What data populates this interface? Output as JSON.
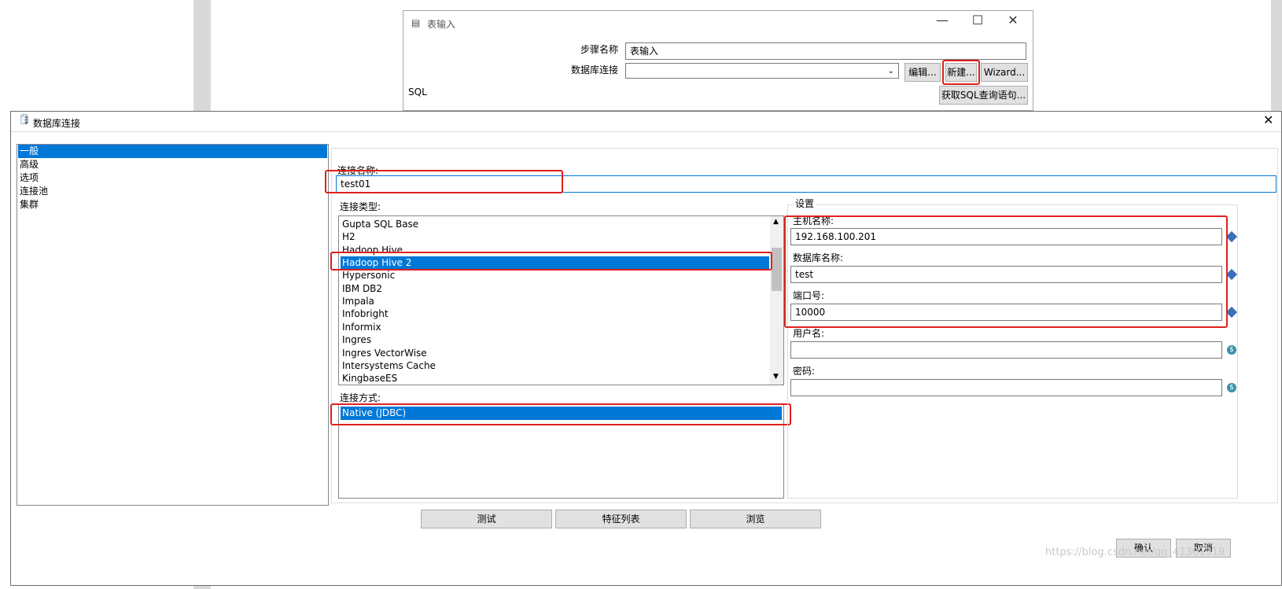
{
  "table_input": {
    "title": "表输入",
    "step_name_label": "步骤名称",
    "step_name_value": "表输入",
    "db_conn_label": "数据库连接",
    "db_conn_value": "",
    "edit_button": "编辑...",
    "new_button": "新建...",
    "wizard_button": "Wizard...",
    "sql_label": "SQL",
    "get_sql_button": "获取SQL查询语句..."
  },
  "dialog": {
    "title": "数据库连接",
    "nav_items": [
      "一般",
      "高级",
      "选项",
      "连接池",
      "集群"
    ],
    "conn_name_label": "连接名称:",
    "conn_name_value": "test01",
    "conn_type_label": "连接类型:",
    "conn_types": [
      "Gupta SQL Base",
      "H2",
      "Hadoop Hive",
      "Hadoop Hive 2",
      "Hypersonic",
      "IBM DB2",
      "Impala",
      "Infobright",
      "Informix",
      "Ingres",
      "Ingres VectorWise",
      "Intersystems Cache",
      "KingbaseES"
    ],
    "selected_conn_type": "Hadoop Hive 2",
    "access_label": "连接方式:",
    "access_methods": [
      "Native (JDBC)"
    ],
    "settings_label": "设置",
    "host_label": "主机名称:",
    "host_value": "192.168.100.201",
    "dbname_label": "数据库名称:",
    "dbname_value": "test",
    "port_label": "端口号:",
    "port_value": "10000",
    "user_label": "用户名:",
    "user_value": "",
    "password_label": "密码:",
    "password_value": "",
    "test_button": "测试",
    "features_button": "特征列表",
    "explore_button": "浏览",
    "ok_button": "确认",
    "cancel_button": "取消"
  },
  "watermark": "https://blog.csdn.net/qq_41301919",
  "colors": {
    "selection": "#0078d7",
    "highlight_box": "#e0201b"
  }
}
